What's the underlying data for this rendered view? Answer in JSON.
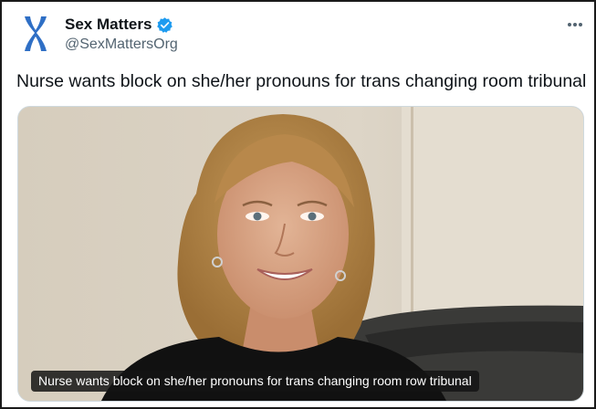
{
  "post": {
    "author_name": "Sex Matters",
    "handle": "@SexMattersOrg",
    "verified": true,
    "text": "Nurse wants block on she/her pronouns for trans changing room tribunal",
    "more_icon": "more-horizontal-icon"
  },
  "media": {
    "caption": "Nurse wants block on she/her pronouns for trans changing room row tribunal"
  },
  "colors": {
    "logo_blue": "#2f6fc5",
    "verified_blue": "#1d9bf0",
    "text_primary": "#0f1419",
    "text_secondary": "#536471"
  }
}
